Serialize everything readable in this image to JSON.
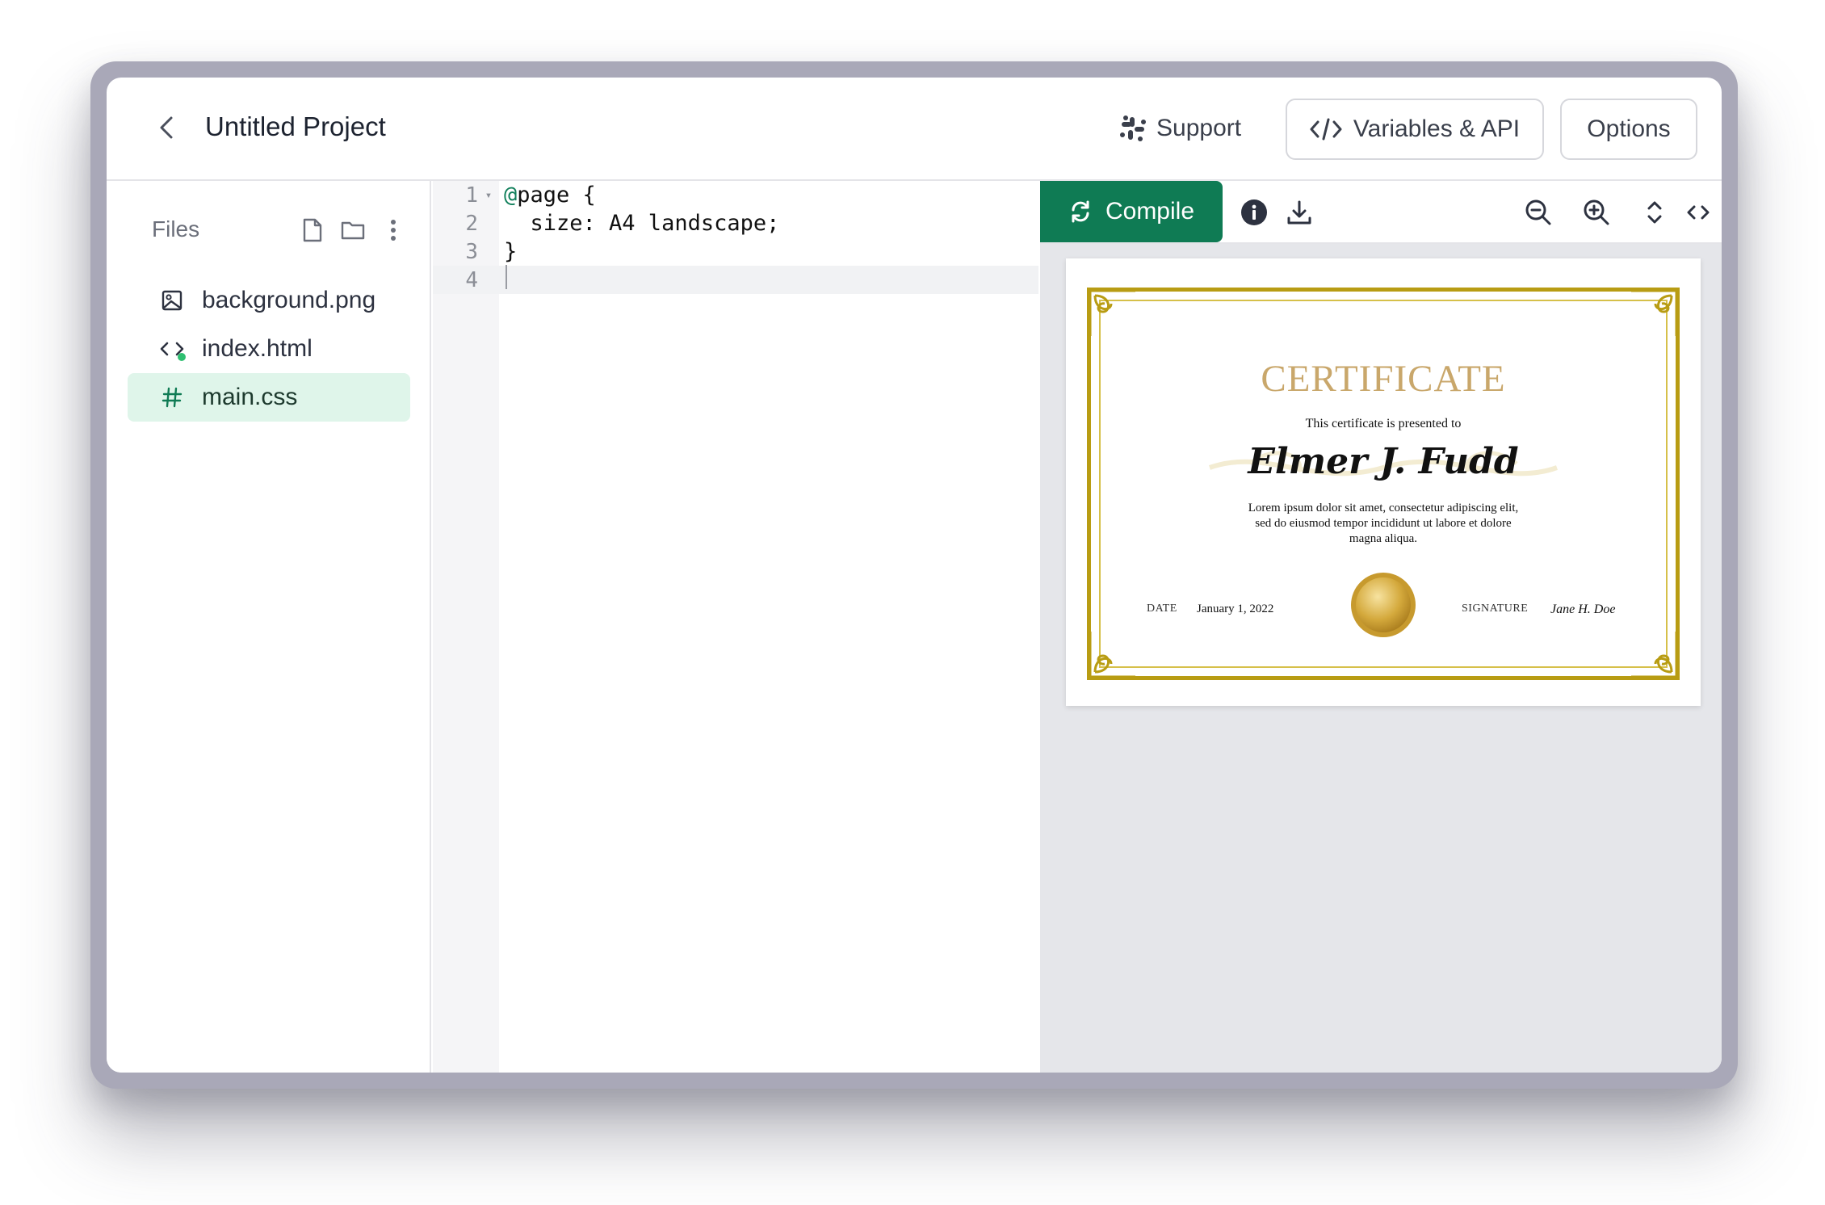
{
  "header": {
    "title": "Untitled Project",
    "support_label": "Support",
    "variables_label": "Variables & API",
    "options_label": "Options"
  },
  "sidebar": {
    "files_label": "Files",
    "files": [
      {
        "name": "background.png",
        "icon": "image-icon"
      },
      {
        "name": "index.html",
        "icon": "code-icon"
      },
      {
        "name": "main.css",
        "icon": "hash-icon",
        "active": true
      }
    ]
  },
  "editor": {
    "lines": [
      {
        "n": "1",
        "at": "@",
        "text": "page {"
      },
      {
        "n": "2",
        "text": "  size: A4 landscape;"
      },
      {
        "n": "3",
        "text": "}"
      },
      {
        "n": "4",
        "text": ""
      }
    ]
  },
  "preview": {
    "compile_label": "Compile",
    "certificate": {
      "title": "CERTIFICATE",
      "subtitle": "This certificate is presented to",
      "name": "Elmer J. Fudd",
      "body": "Lorem ipsum dolor sit amet, consectetur adipiscing elit, sed do eiusmod tempor incididunt ut labore et dolore magna aliqua.",
      "date_label": "DATE",
      "date_value": "January 1, 2022",
      "signature_label": "SIGNATURE",
      "signature_value": "Jane H. Doe"
    }
  },
  "colors": {
    "accent": "#0f7b54",
    "active_file_bg": "#dff5ea",
    "cert_gold": "#b89c13",
    "cert_title": "#c9a76b"
  }
}
